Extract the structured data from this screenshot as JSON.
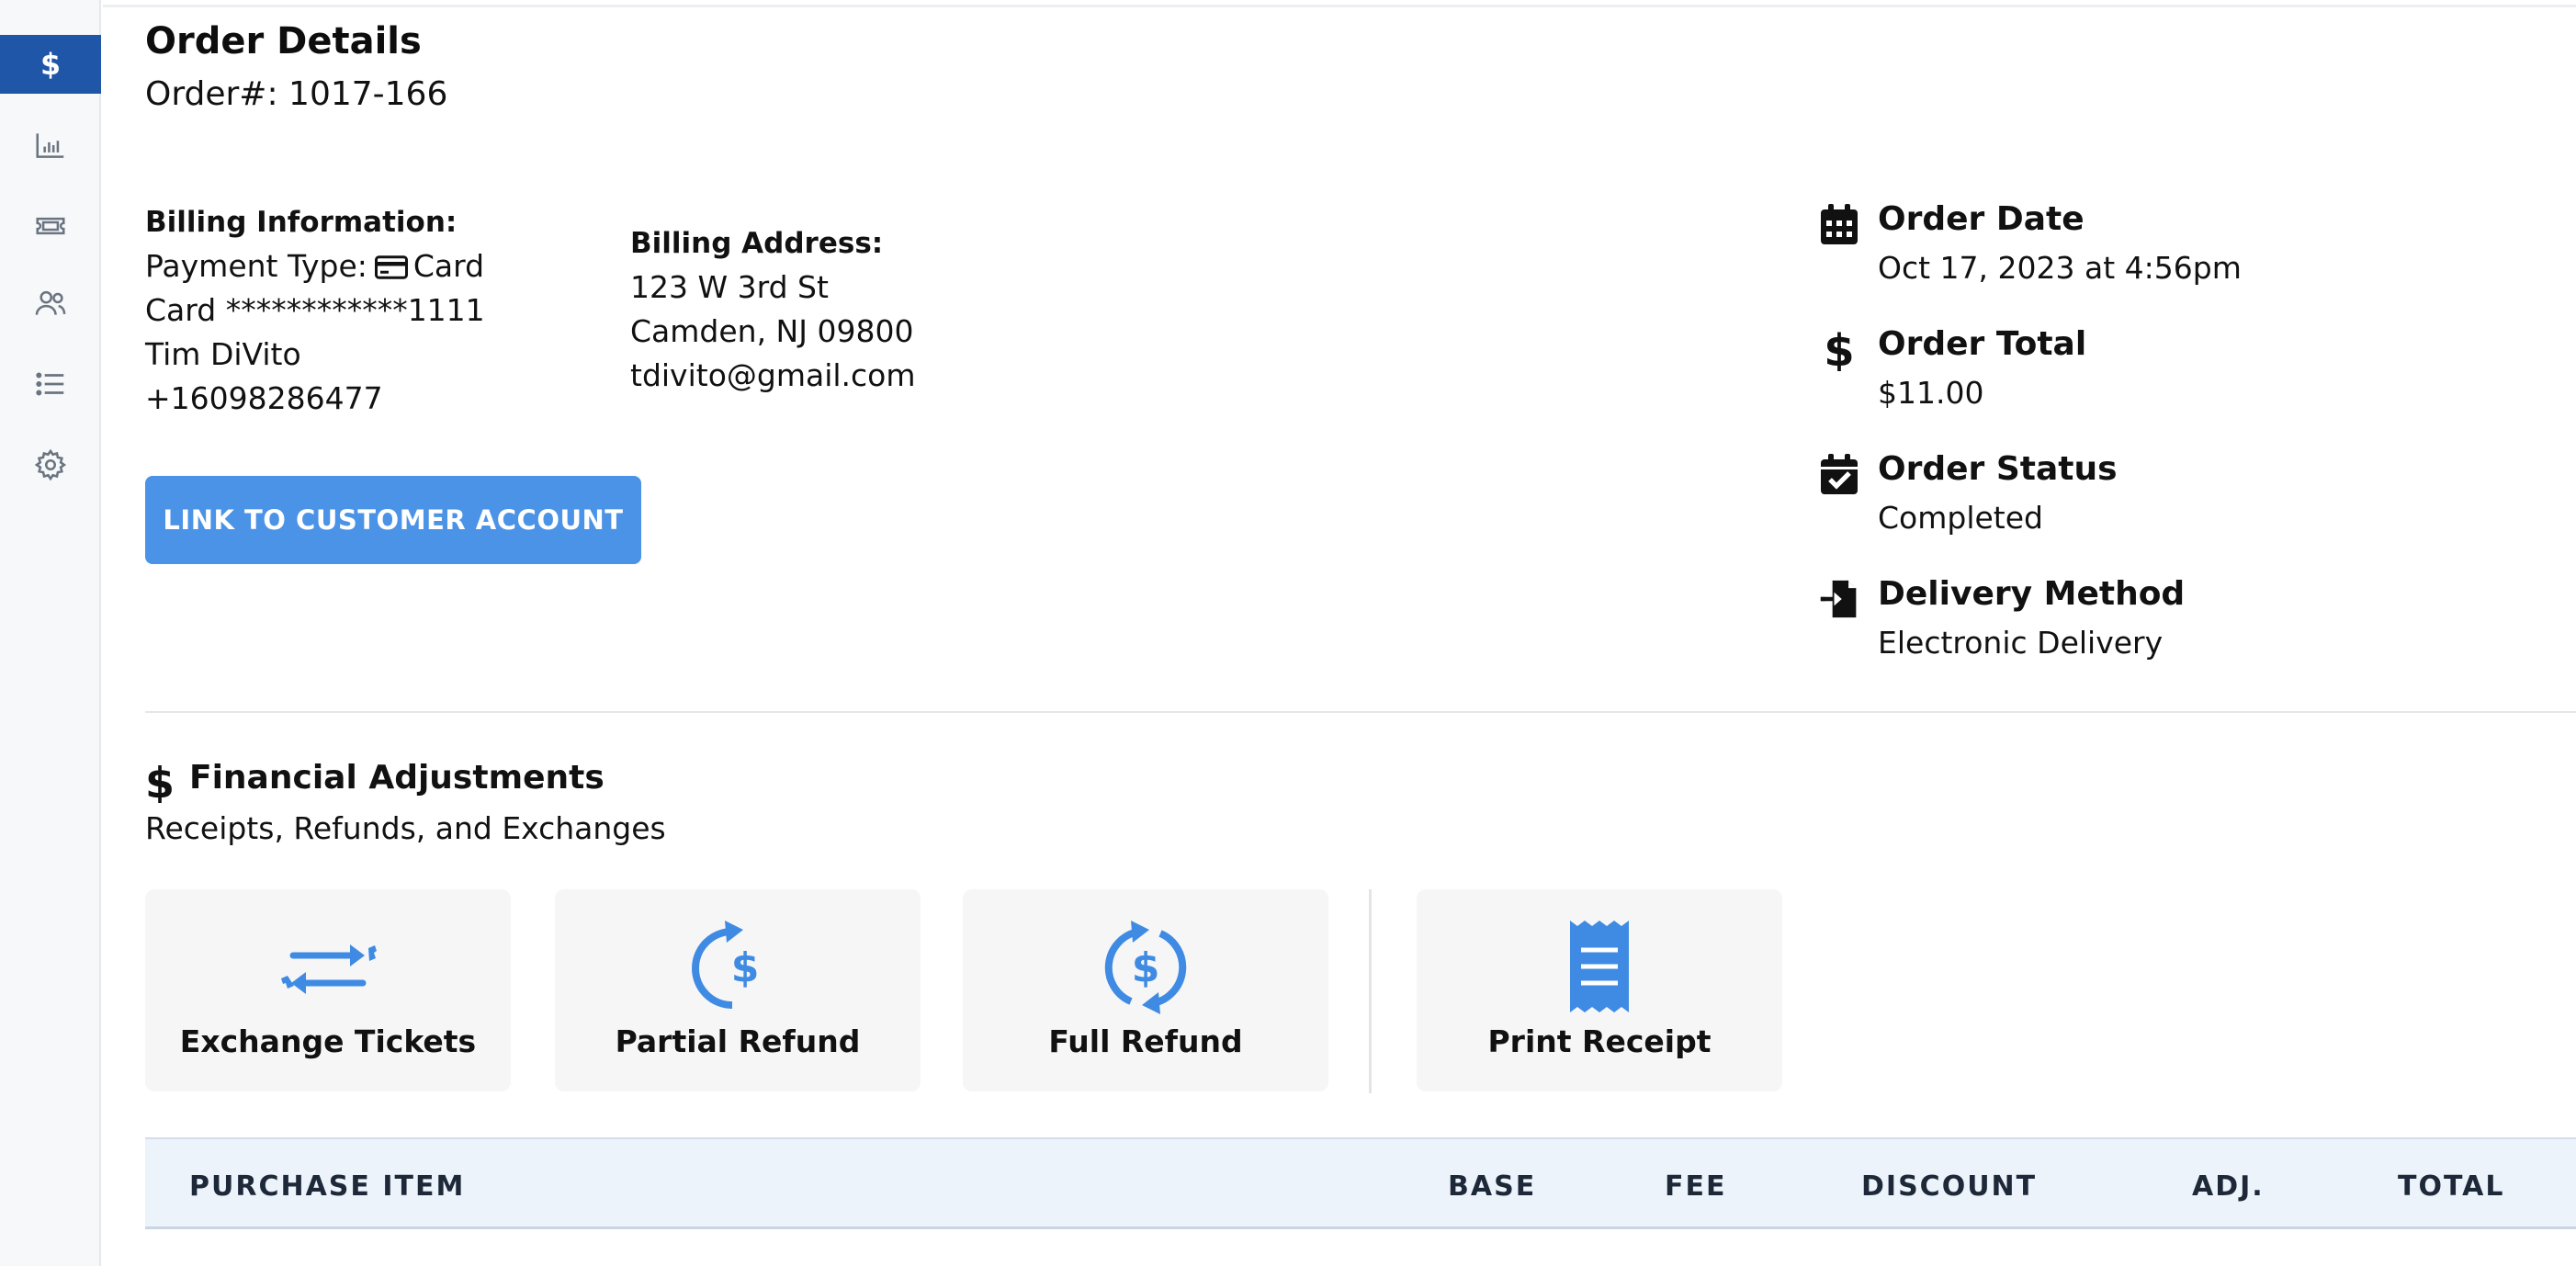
{
  "sidebar": {
    "items": [
      {
        "icon": "dollar-icon",
        "active": true
      },
      {
        "icon": "bar-chart-icon",
        "active": false
      },
      {
        "icon": "ticket-icon",
        "active": false
      },
      {
        "icon": "users-icon",
        "active": false
      },
      {
        "icon": "list-icon",
        "active": false
      },
      {
        "icon": "gear-icon",
        "active": false
      }
    ]
  },
  "header": {
    "title": "Order Details",
    "order_number": "Order#: 1017-166"
  },
  "billing_info": {
    "heading": "Billing Information:",
    "payment_type_label": "Payment Type:",
    "payment_type_value": "Card",
    "card": "Card ************1111",
    "name": "Tim DiVito",
    "phone": "+16098286477"
  },
  "billing_address": {
    "heading": "Billing Address:",
    "line1": "123 W 3rd St",
    "line2": "Camden, NJ 09800",
    "email": "tdivito@gmail.com"
  },
  "link_button_label": "LINK TO CUSTOMER ACCOUNT",
  "order_meta": {
    "date_label": "Order Date",
    "date_value": "Oct 17, 2023 at 4:56pm",
    "total_label": "Order Total",
    "total_value": "$11.00",
    "status_label": "Order Status",
    "status_value": "Completed",
    "delivery_label": "Delivery Method",
    "delivery_value": "Electronic Delivery"
  },
  "financial": {
    "title": "Financial Adjustments",
    "subtitle": "Receipts, Refunds, and Exchanges",
    "actions": [
      {
        "label": "Exchange Tickets",
        "icon": "exchange-icon"
      },
      {
        "label": "Partial Refund",
        "icon": "partial-refund-icon"
      },
      {
        "label": "Full Refund",
        "icon": "full-refund-icon"
      },
      {
        "label": "Print Receipt",
        "icon": "receipt-icon"
      }
    ]
  },
  "table": {
    "columns": [
      "PURCHASE ITEM",
      "BASE",
      "FEE",
      "DISCOUNT",
      "ADJ.",
      "TOTAL"
    ]
  },
  "colors": {
    "sidebar_active": "#1f56a8",
    "primary_button": "#4b93e6",
    "icon_blue": "#3f8be3",
    "table_header_bg": "#edf3fb"
  }
}
